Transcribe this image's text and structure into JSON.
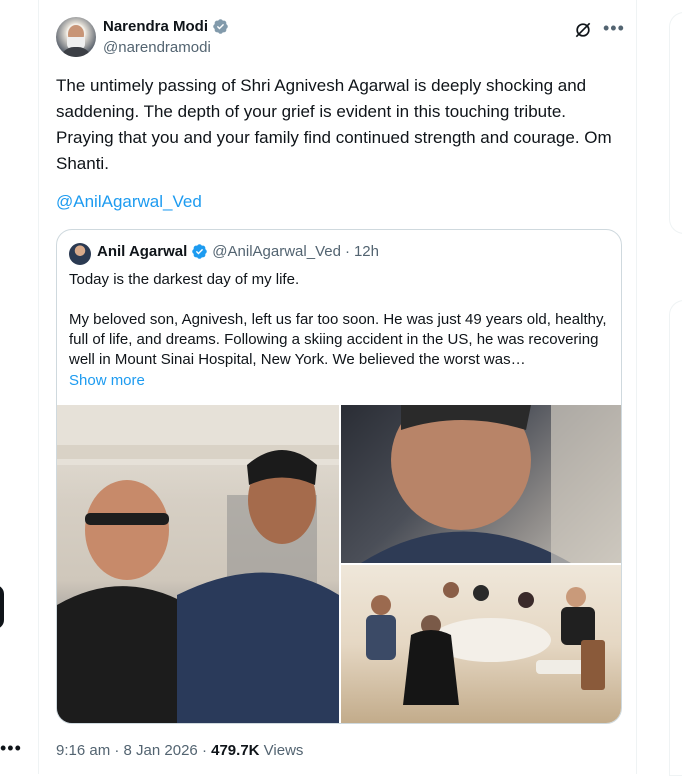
{
  "author": {
    "name": "Narendra Modi",
    "handle": "@narendramodi"
  },
  "tweet": {
    "text": "The untimely passing of Shri Agnivesh Agarwal is deeply shocking and saddening. The depth of your grief is evident in this touching tribute. Praying that you and your family find continued strength and courage. Om Shanti.",
    "mention": "@AnilAgarwal_Ved",
    "time": "9:16 am",
    "date": "8 Jan 2026",
    "views_count": "479.7K",
    "views_label": "Views"
  },
  "quote": {
    "name": "Anil Agarwal",
    "handle": "@AnilAgarwal_Ved",
    "age": "12h",
    "line1": "Today is the darkest day of my life.",
    "paragraph": "My beloved son, Agnivesh, left us far too soon. He was just 49 years old, healthy, full of life, and dreams. Following a skiing accident in the US, he was recovering well in Mount Sinai Hospital, New York. We believed the worst was…",
    "show_more": "Show more"
  },
  "icons": {
    "verified": "verified-badge-icon",
    "grok": "grok-icon",
    "more": "more-icon"
  },
  "colors": {
    "accent": "#1d9bf0",
    "text": "#0f1419",
    "muted": "#536471"
  }
}
